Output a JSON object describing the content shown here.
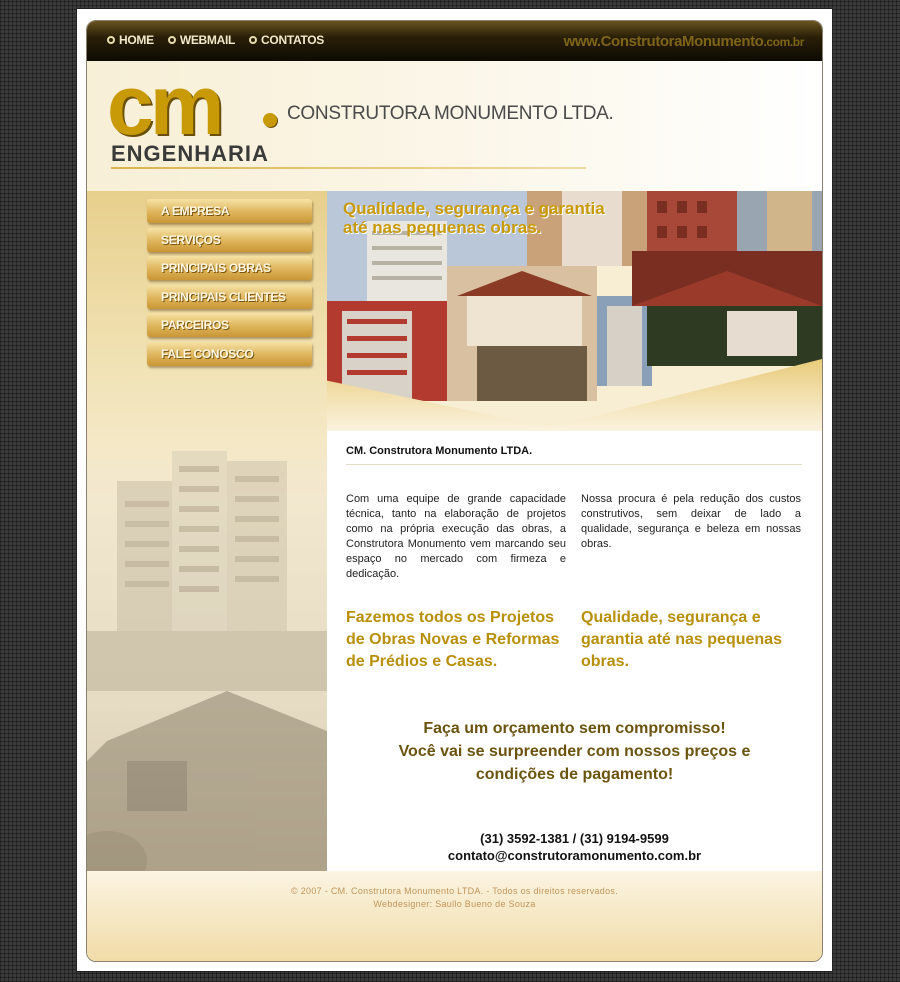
{
  "topnav": {
    "items": [
      {
        "label": "HOME"
      },
      {
        "label": "WEBMAIL"
      },
      {
        "label": "CONTATOS"
      }
    ],
    "site_url_main": "www.ConstrutoraMonumento",
    "site_url_tld": ".com.br"
  },
  "header": {
    "logo_text": "cm",
    "logo_sub": "ENGENHARIA",
    "company_name": "CONSTRUTORA MONUMENTO LTDA."
  },
  "sidebar": {
    "items": [
      {
        "label": "A EMPRESA"
      },
      {
        "label": "SERVIÇOS"
      },
      {
        "label": "PRINCIPAIS OBRAS"
      },
      {
        "label": "PRINCIPAIS CLIENTES"
      },
      {
        "label": "PARCEIROS"
      },
      {
        "label": "FALE CONOSCO"
      }
    ]
  },
  "banner": {
    "caption": "Qualidade, segurança e garantia até nas pequenas obras."
  },
  "content": {
    "title": "CM. Construtora Monumento LTDA.",
    "paragraph_left": "Com uma equipe de grande capacidade técnica, tanto na elaboração de projetos como na própria execução das obras, a Construtora Monumento vem marcando seu espaço no mercado com firmeza e dedicação.",
    "paragraph_right": "Nossa procura é pela redução dos custos construtivos, sem deixar de lado a qualidade, segurança e beleza em nossas obras.",
    "highlight_left": "Fazemos todos os Projetos de Obras Novas e Reformas de Prédios e Casas.",
    "highlight_right": "Qualidade, segurança e garantia até nas pequenas obras.",
    "offer_line1": "Faça um orçamento sem compromisso!",
    "offer_line2": "Você vai se surpreender com nossos preços e",
    "offer_line3": "condições de pagamento!",
    "phones": "(31) 3592-1381 / (31) 9194-9599",
    "email": "contato@construtoramonumento.com.br"
  },
  "footer": {
    "copyright": "© 2007 - CM. Construtora Monumento LTDA. - Todos os direitos reservados.",
    "webdesigner": "Webdesigner: Saullo Bueno de Souza"
  }
}
